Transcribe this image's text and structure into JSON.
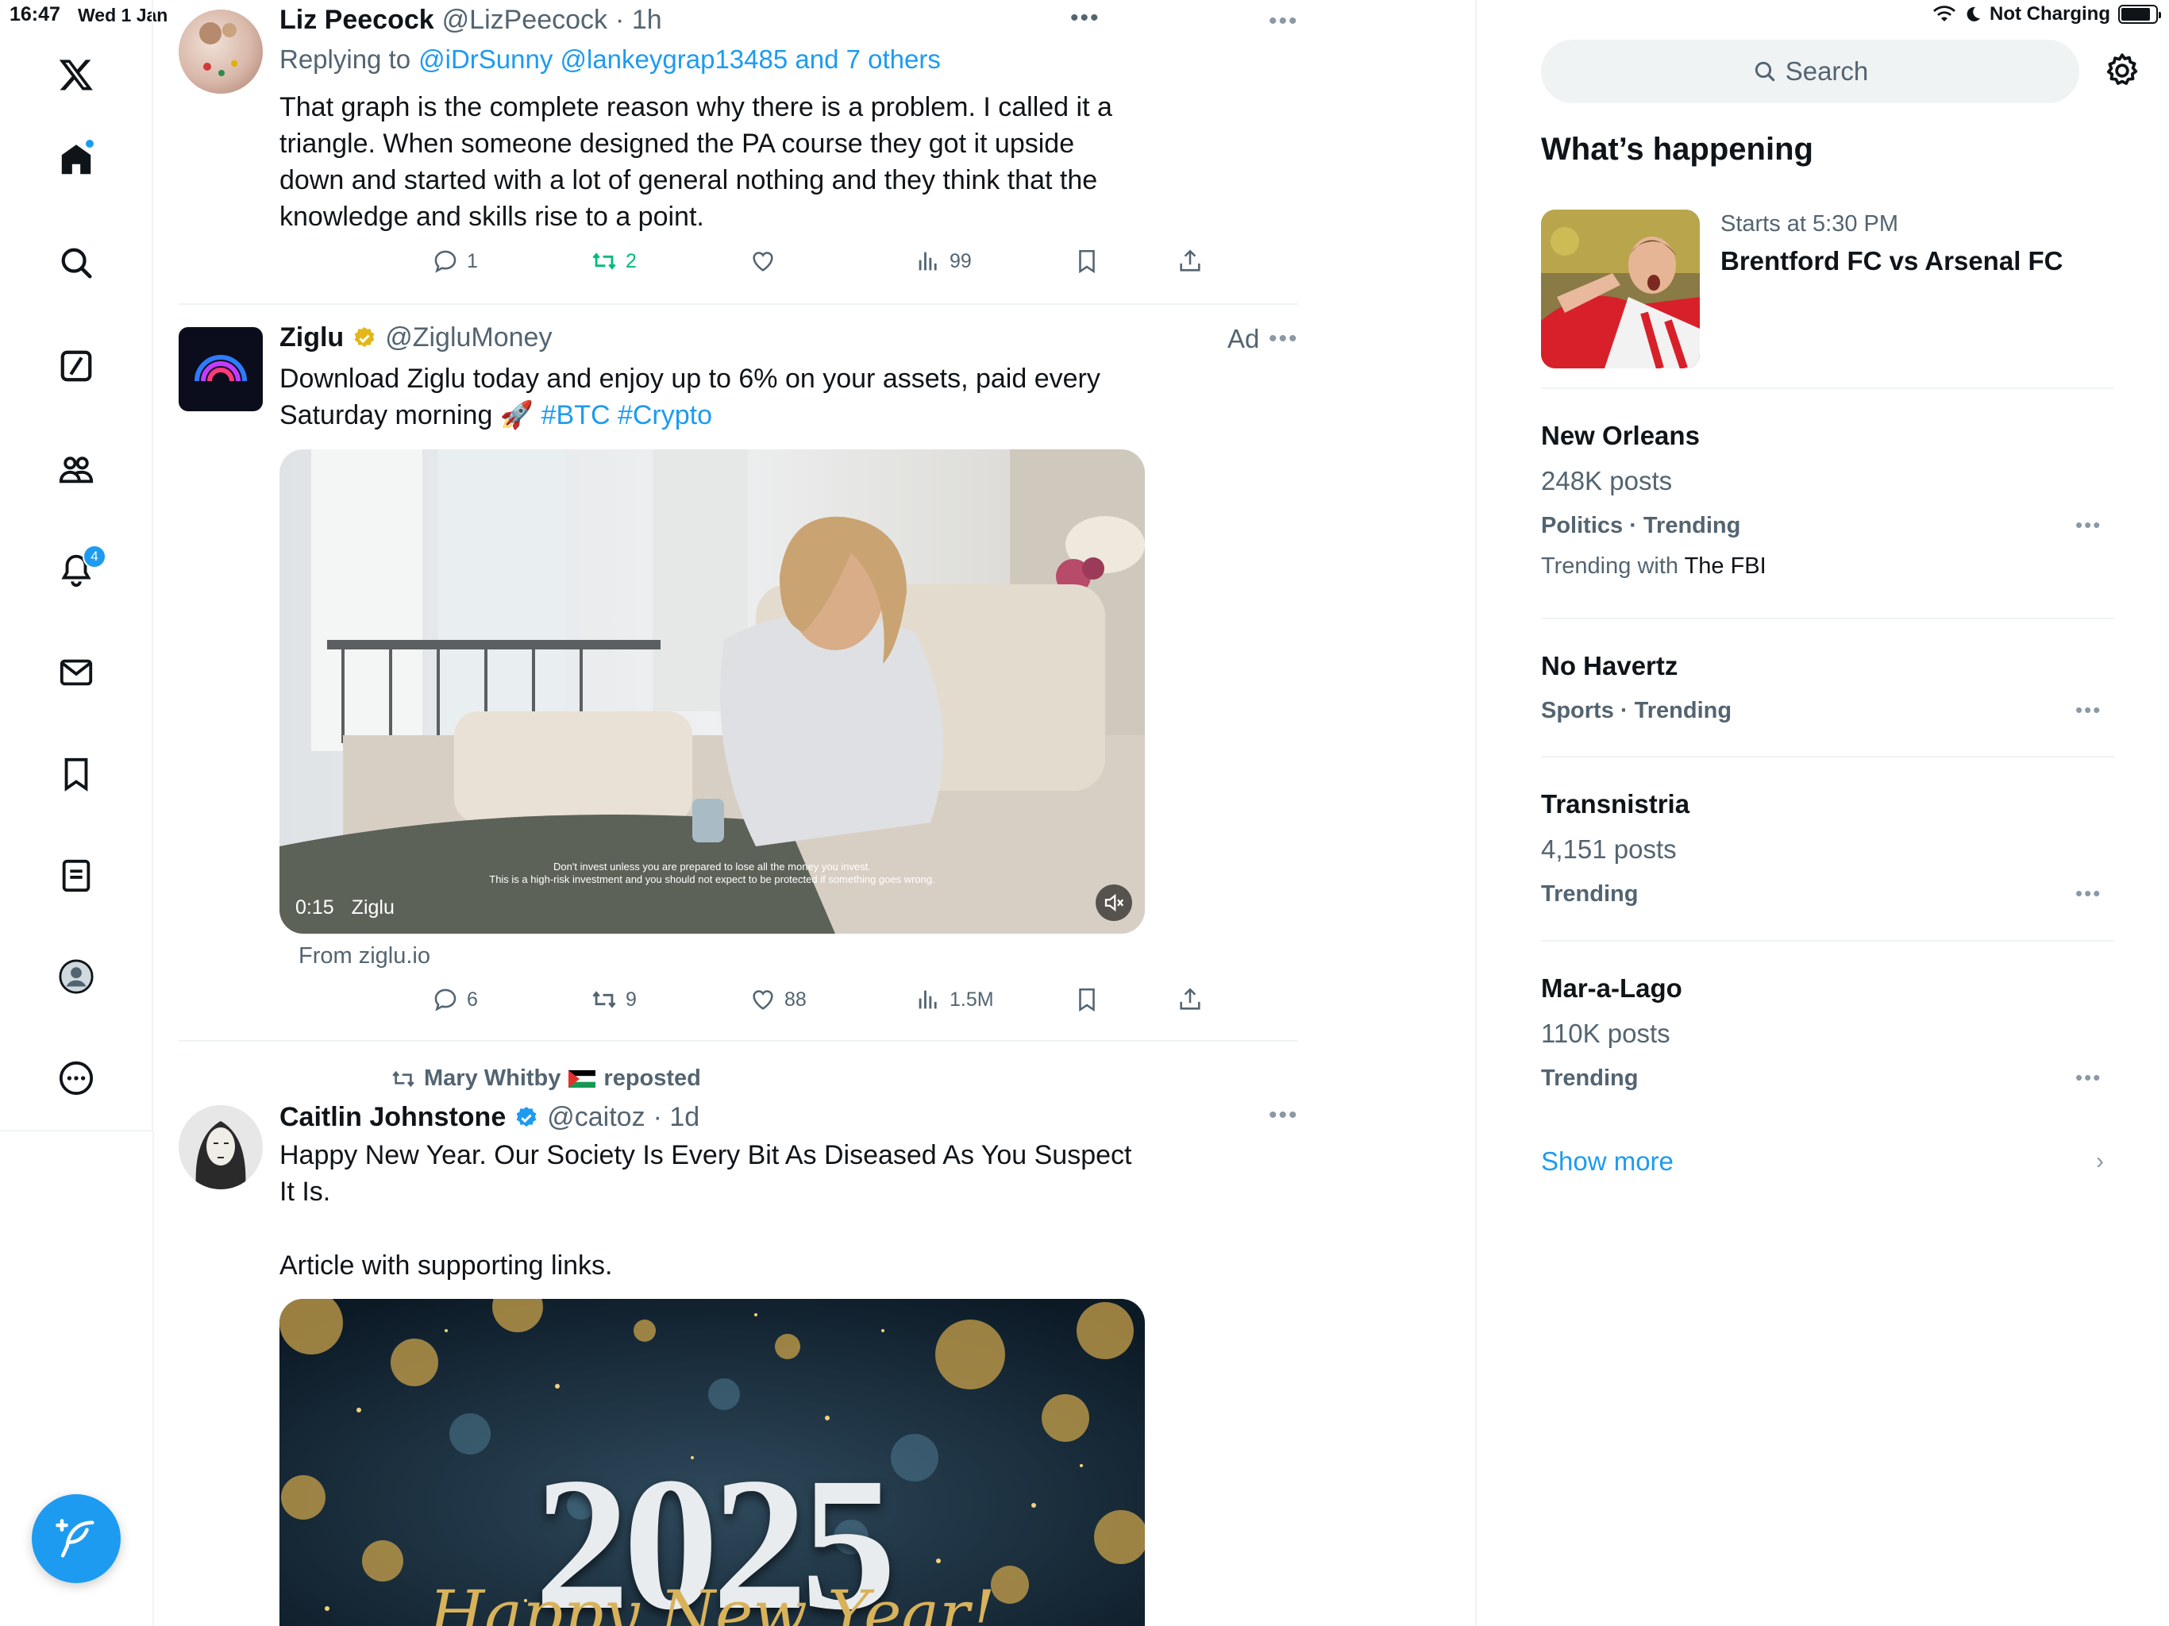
{
  "status_bar": {
    "time": "16:47",
    "date": "Wed 1 Jan",
    "battery_label": "Not Charging",
    "battery_level": 0.85
  },
  "nav": {
    "items": [
      "x-logo-icon",
      "home-icon",
      "explore-icon",
      "grok-icon",
      "communities-icon",
      "notifications-icon",
      "messages-icon",
      "bookmarks-icon",
      "lists-icon",
      "profile-icon",
      "more-icon"
    ],
    "notifications_badge": "4",
    "compose_icon": "compose-feather-icon"
  },
  "tweets": [
    {
      "name": "Liz Peecock",
      "handle": "@LizPeecock",
      "time": "· 1h",
      "replying_prefix": "Replying to",
      "replying_to": "@iDrSunny @lankeygrap13485 and 7 others",
      "text": "That graph is the complete reason why there is a problem.  I called it a triangle.  When someone designed the PA course they got it upside down and started with a lot of general nothing and they think that the knowledge and skills rise to a point.",
      "replies": "1",
      "reposts": "2",
      "likes": "",
      "views": "99"
    },
    {
      "name": "Ziglu",
      "handle": "@ZigluMoney",
      "ad_label": "Ad",
      "text": "Download Ziglu today and enjoy up to 6% on your assets, paid every Saturday morning 🚀",
      "hashtags": "#BTC #Crypto",
      "video_time": "0:15",
      "video_source": "Ziglu",
      "disclaimer_1": "Don't invest unless you are prepared to lose all the money you invest.",
      "disclaimer_2": "This is a high-risk investment and you should not expect to be protected if something goes wrong.",
      "from_label": "From ziglu.io",
      "replies": "6",
      "reposts": "9",
      "likes": "88",
      "views": "1.5M"
    },
    {
      "repost_by": "Mary Whitby",
      "repost_label": "reposted",
      "name": "Caitlin Johnstone",
      "handle": "@caitoz",
      "time": "· 1d",
      "text_1": "Happy New Year. Our Society Is Every Bit As Diseased As You Suspect It Is.",
      "text_2": "Article with supporting links.",
      "image_text": "2025",
      "image_script": "Happy New Year!"
    }
  ],
  "right": {
    "search_placeholder": "Search",
    "section_title": "What’s happening",
    "event": {
      "time": "Starts at 5:30 PM",
      "title": "Brentford FC vs Arsenal FC"
    },
    "trends": [
      {
        "name": "New Orleans",
        "count": "248K posts",
        "category": "Politics · Trending",
        "with_prefix": "Trending with",
        "with": "The FBI"
      },
      {
        "name": "No Havertz",
        "count": "",
        "category": "Sports · Trending",
        "with_prefix": "",
        "with": ""
      },
      {
        "name": "Transnistria",
        "count": "4,151 posts",
        "category": "Trending",
        "with_prefix": "",
        "with": ""
      },
      {
        "name": "Mar-a-Lago",
        "count": "110K posts",
        "category": "Trending",
        "with_prefix": "",
        "with": ""
      }
    ],
    "show_more": "Show more"
  },
  "colors": {
    "accent": "#1d9bf0",
    "repost_green": "#00ba7c",
    "muted_text": "#536471",
    "divider": "#eff3f4"
  }
}
